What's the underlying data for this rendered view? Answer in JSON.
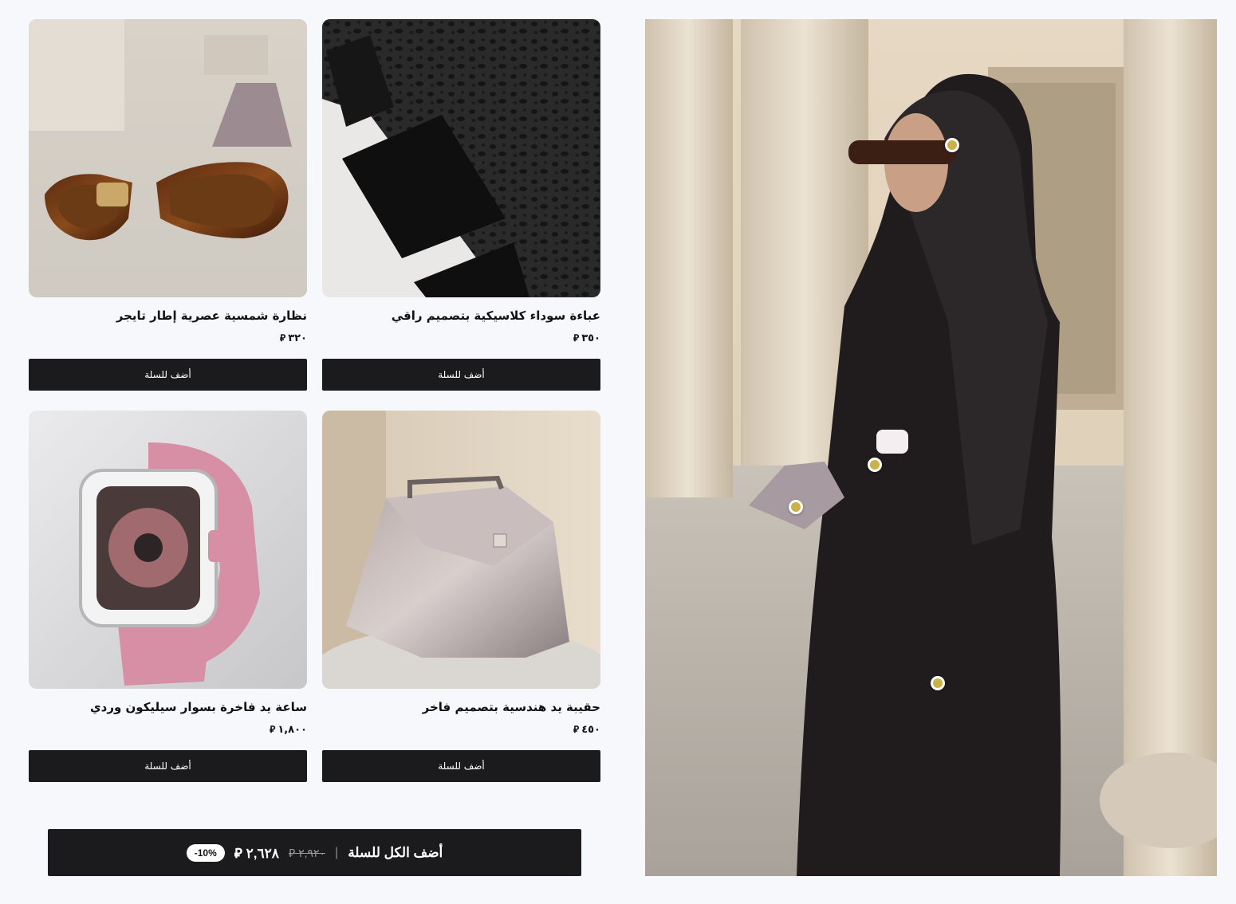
{
  "products": [
    {
      "id": "abaya",
      "title": "عباءة سوداء كلاسيكية بتصميم راقي",
      "price": "٣٥٠",
      "currency": "⃁",
      "button": "أضف للسلة"
    },
    {
      "id": "sunglasses",
      "title": "نظارة شمسية عصرية إطار تايجر",
      "price": "٣٢٠",
      "currency": "⃁",
      "button": "أضف للسلة"
    },
    {
      "id": "handbag",
      "title": "حقيبة يد هندسية بتصميم فاخر",
      "price": "٤٥٠",
      "currency": "⃁",
      "button": "أضف للسلة"
    },
    {
      "id": "watch",
      "title": "ساعة يد فاخرة بسوار سيليكون وردي",
      "price": "١,٨٠٠",
      "currency": "⃁",
      "button": "أضف للسلة"
    }
  ],
  "add_all": {
    "label": "أضف الكل للسلة",
    "separator": "|",
    "original_price": "٢,٩٢٠",
    "total_price": "٢,٦٢٨",
    "currency": "⃁",
    "discount_badge": "-10%"
  },
  "colors": {
    "button_bg": "#1b1b1d",
    "hotspot": "#c9b24a",
    "page_bg": "#f7f8fb"
  }
}
